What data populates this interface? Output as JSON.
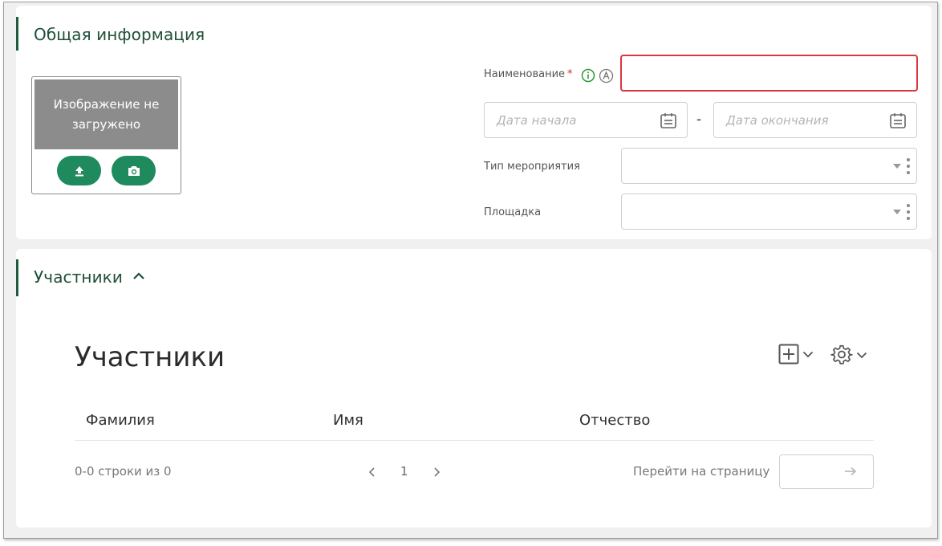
{
  "general": {
    "title": "Общая информация",
    "image_placeholder": "Изображение не загружено",
    "upload_icon": "upload-icon",
    "camera_icon": "camera-icon",
    "name_label": "Наименование",
    "required_mark": "*",
    "name_value": "",
    "start_date_placeholder": "Дата начала",
    "date_separator": "-",
    "end_date_placeholder": "Дата окончания",
    "event_type_label": "Тип мероприятия",
    "event_type_value": "",
    "venue_label": "Площадка",
    "venue_value": ""
  },
  "participants_section": {
    "title": "Участники"
  },
  "table": {
    "title": "Участники",
    "columns": [
      "Фамилия",
      "Имя",
      "Отчество"
    ],
    "rows": [],
    "summary": "0-0 строки из 0",
    "current_page": "1",
    "goto_label": "Перейти на страницу",
    "goto_value": ""
  },
  "colors": {
    "accent": "#1e8a5e",
    "section_title": "#1e4f37",
    "error_border": "#d9363e",
    "info_icon": "#2e9a2e"
  }
}
